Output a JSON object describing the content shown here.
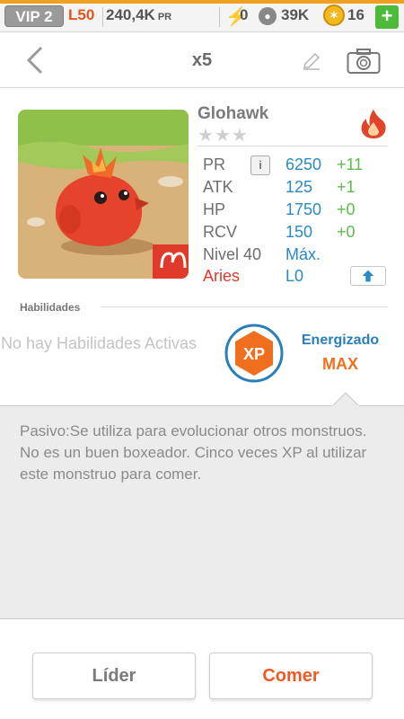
{
  "status_bar": {
    "vip": "VIP 2",
    "level": "L50",
    "power": "240,4K",
    "power_unit": "PR",
    "energy": "0",
    "monsters": "39K",
    "coins": "16",
    "add_label": "+"
  },
  "nav": {
    "title": "x5"
  },
  "monster": {
    "name": "Glohawk",
    "stars": "★★★",
    "element": "fire-icon",
    "stats": [
      {
        "label": "PR",
        "value": "6250",
        "bonus": "+11"
      },
      {
        "label": "ATK",
        "value": "125",
        "bonus": "+1"
      },
      {
        "label": "HP",
        "value": "1750",
        "bonus": "+0"
      },
      {
        "label": "RCV",
        "value": "150",
        "bonus": "+0"
      }
    ],
    "level_label": "Nivel 40",
    "level_value": "Máx.",
    "sign_label": "Aries",
    "sign_value": "L0",
    "info_label": "i"
  },
  "skills": {
    "title": "Habilidades",
    "empty_text": "No hay Habilidades Activas",
    "xp_badge": "XP",
    "energized_label": "Energizado",
    "energized_value": "MAX"
  },
  "description": "Pasivo:Se utiliza para evolucionar otros monstruos. No es un buen boxeador. Cinco veces XP al utilizar este monstruo para comer.",
  "actions": {
    "leader": "Líder",
    "eat": "Comer"
  },
  "colors": {
    "accent_blue": "#2a8ac6",
    "accent_green": "#5bbd4a",
    "accent_orange": "#ec5a25",
    "sign_red": "#e03a2b"
  }
}
